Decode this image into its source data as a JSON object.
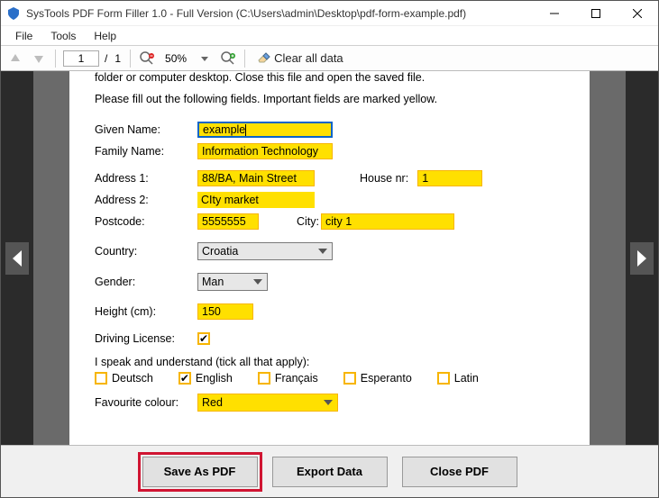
{
  "window": {
    "title": "SysTools PDF Form Filler 1.0 - Full Version (C:\\Users\\admin\\Desktop\\pdf-form-example.pdf)"
  },
  "menu": {
    "file": "File",
    "tools": "Tools",
    "help": "Help"
  },
  "toolbar": {
    "page_current": "1",
    "page_sep": "/",
    "page_total": "1",
    "zoom": "50%",
    "clear": "Clear all data"
  },
  "help1": "folder or computer desktop. Close this file and open the saved file.",
  "help2": "Please fill out the following fields. Important fields are marked yellow.",
  "labels": {
    "given": "Given Name:",
    "family": "Family Name:",
    "addr1": "Address 1:",
    "addr2": "Address 2:",
    "house": "House nr:",
    "postcode": "Postcode:",
    "city": "City:",
    "country": "Country:",
    "gender": "Gender:",
    "height": "Height (cm):",
    "license": "Driving License:",
    "speak": "I speak and understand (tick all that apply):",
    "favcolor": "Favourite colour:"
  },
  "values": {
    "given": "example",
    "family": "Information Technology",
    "addr1": "88/BA, Main Street",
    "addr2": "CIty market",
    "house": "1",
    "postcode": "5555555",
    "city": "city 1",
    "country": "Croatia",
    "gender": "Man",
    "height": "150",
    "favcolor": "Red"
  },
  "langs": {
    "de": "Deutsch",
    "en": "English",
    "fr": "Français",
    "eo": "Esperanto",
    "la": "Latin"
  },
  "buttons": {
    "save": "Save As PDF",
    "export": "Export Data",
    "close": "Close PDF"
  }
}
